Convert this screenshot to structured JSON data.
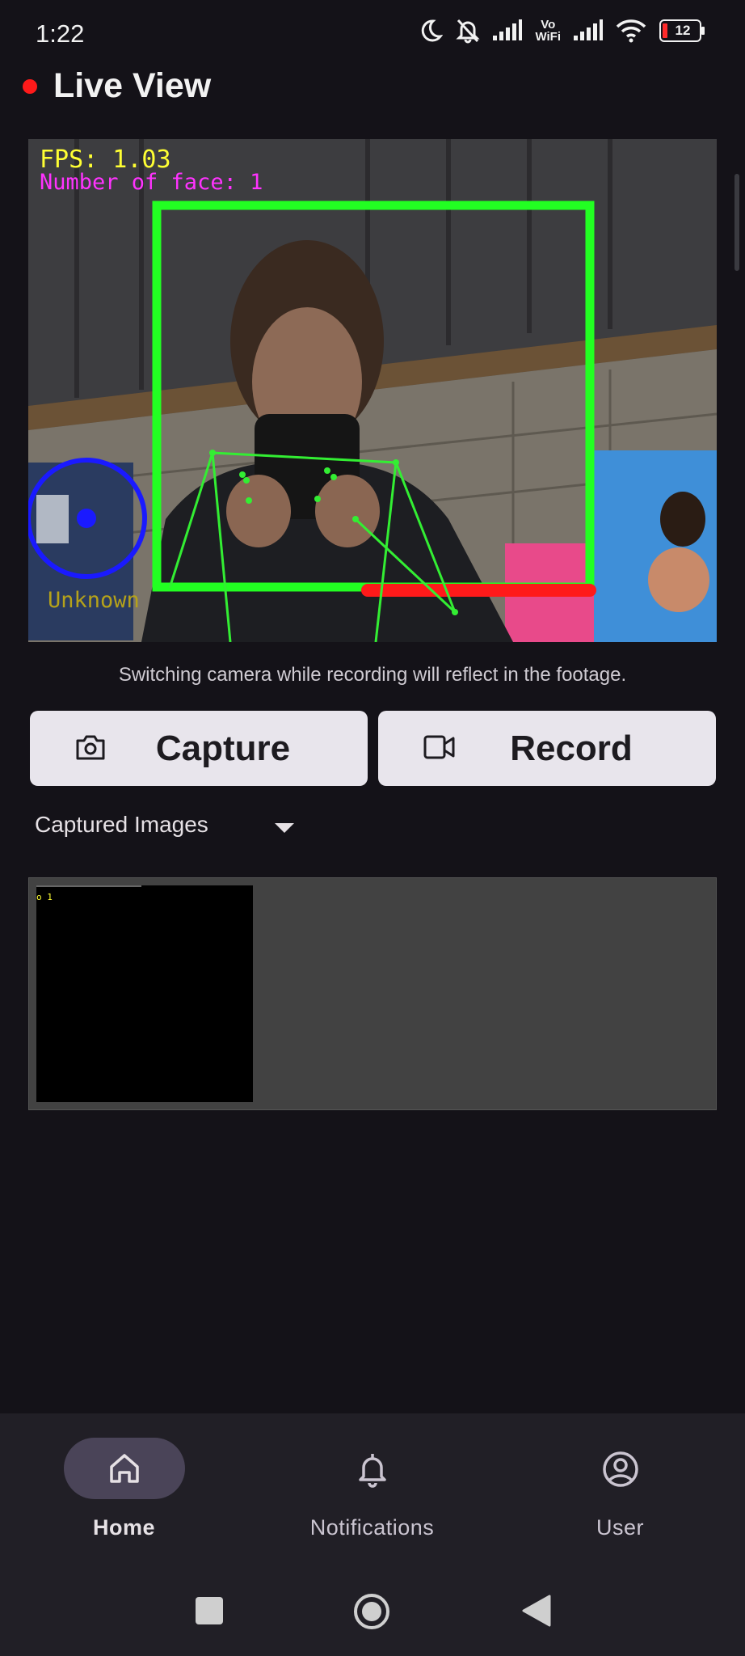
{
  "status_bar": {
    "time": "1:22",
    "vowifi_top": "Vo",
    "vowifi_bottom": "WiFi",
    "battery": "12",
    "icons": [
      "moon-icon",
      "bell-off-icon",
      "signal-icon",
      "vowifi-icon",
      "signal-icon",
      "wifi-icon",
      "battery-icon"
    ]
  },
  "header": {
    "title": "Live View",
    "live_indicator_color": "#ff1a1a"
  },
  "camera_feed": {
    "fps_text": "FPS: 1.03",
    "faces_text": "Number of face: 1",
    "label_text": "Unknown"
  },
  "hint": "Switching camera while recording will reflect in the footage.",
  "actions": {
    "capture_label": "Capture",
    "record_label": "Record"
  },
  "gallery": {
    "dropdown_label": "Captured Images",
    "thumb_overlay_text": "o 1"
  },
  "nav": {
    "items": [
      {
        "label": "Home",
        "icon": "home-icon",
        "active": true
      },
      {
        "label": "Notifications",
        "icon": "bell-icon",
        "active": false
      },
      {
        "label": "User",
        "icon": "account-circle-icon",
        "active": false
      }
    ]
  },
  "colors": {
    "background": "#141218",
    "button_bg": "#e8e5ec",
    "nav_bg": "#211f26",
    "nav_active_pill": "#4a4458",
    "face_box": "#22ff22",
    "fps_text": "#ffff33",
    "faces_text": "#ff33ff"
  }
}
